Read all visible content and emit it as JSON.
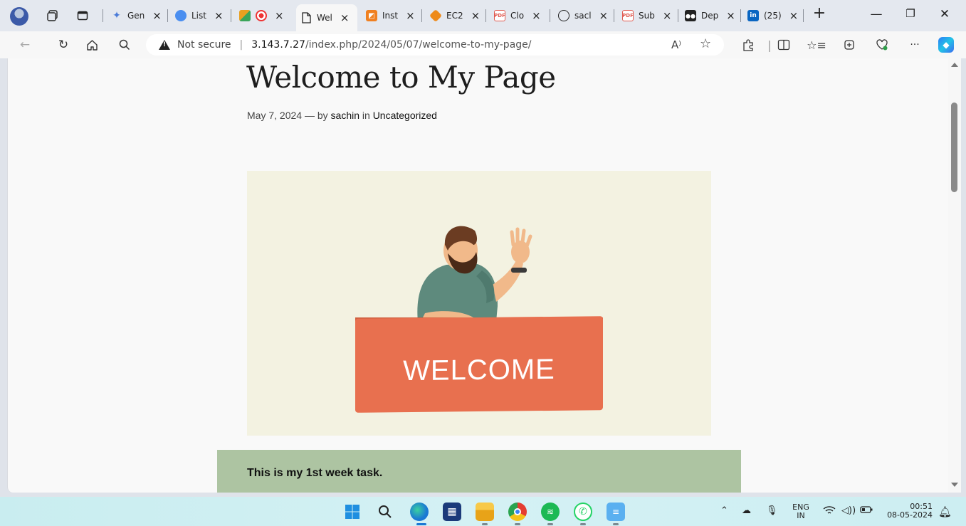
{
  "tabs": [
    {
      "label": "Gen",
      "favicon": "sparkle-icon",
      "color": "#4a7bd8"
    },
    {
      "label": "List",
      "favicon": "circle-favicon",
      "color": "#4a8ef0"
    },
    {
      "label": "",
      "favicon": "colorful-app-icon",
      "color": "#e8a020",
      "extra_icon": "record-icon"
    },
    {
      "label": "Wel",
      "favicon": "page-icon",
      "color": "#ffffff",
      "active": true
    },
    {
      "label": "Inst",
      "favicon": "orange-square-icon",
      "color": "#f08020"
    },
    {
      "label": "EC2",
      "favicon": "cube-icon",
      "color": "#ee8a1a"
    },
    {
      "label": "Clo",
      "favicon": "pdf-icon",
      "color": "#e05a50"
    },
    {
      "label": "sacl",
      "favicon": "github-icon",
      "color": "#222222"
    },
    {
      "label": "Sub",
      "favicon": "pdf-icon",
      "color": "#e05a50"
    },
    {
      "label": "Dep",
      "favicon": "medium-icon",
      "color": "#222222"
    },
    {
      "label": "(25)",
      "favicon": "linkedin-icon",
      "color": "#0a66c2"
    }
  ],
  "tab_close_glyph": "×",
  "new_tab_glyph": "+",
  "window_controls": {
    "minimize": "—",
    "restore": "❐",
    "close": "✕"
  },
  "address_bar": {
    "security_label": "Not secure",
    "separator": "|",
    "url_host": "3.143.7.27",
    "url_path": "/index.php/2024/05/07/welcome-to-my-page/",
    "read_aloud": "A⁾",
    "favorite": "☆"
  },
  "post": {
    "title": "Welcome to My Page",
    "date": "May 7, 2024",
    "dash": "—",
    "by_label": "by",
    "author": "sachin",
    "in_label": "in",
    "category": "Uncategorized",
    "image_text": "WELCOME",
    "block_text": "This is my 1st week task."
  },
  "taskbar": {
    "language_top": "ENG",
    "language_bottom": "IN",
    "time": "00:51",
    "date": "08-05-2024"
  },
  "colors": {
    "hero_bg": "#f3f2e1",
    "banner": "#e8704f",
    "task_block": "#adc4a2"
  }
}
